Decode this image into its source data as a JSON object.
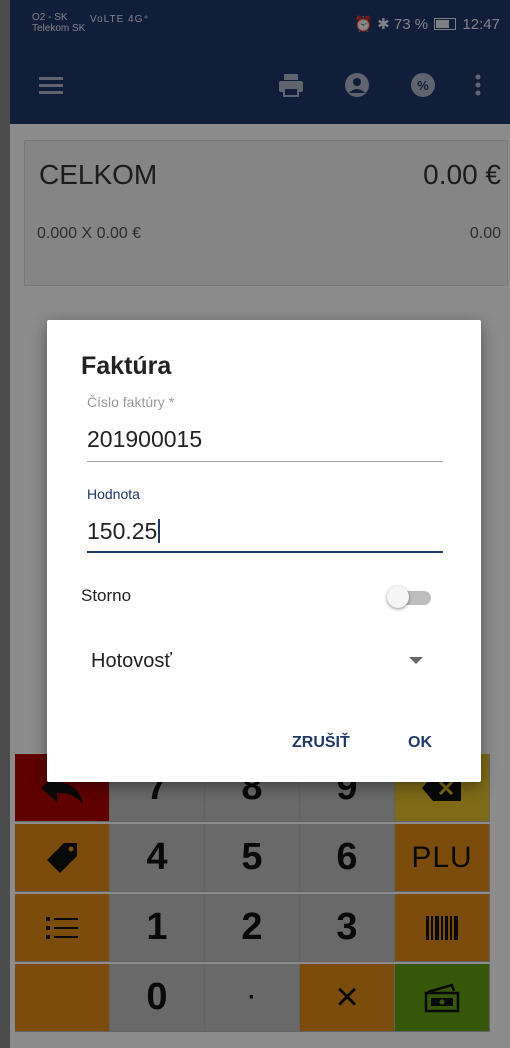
{
  "status_bar": {
    "carrier_line1": "O2 - SK",
    "carrier_line2": "Telekom SK",
    "network_badges": "VoLTE 4G⁺",
    "battery_percent": "73 %",
    "time": "12:47"
  },
  "app_bar": {
    "icons": [
      "menu-icon",
      "printer-icon",
      "account-icon",
      "discount-icon",
      "more-vert-icon"
    ]
  },
  "total": {
    "label": "CELKOM",
    "value": "0.00 €",
    "line_left": "0.000  X  0.00  €",
    "line_right": "0.00"
  },
  "dialog": {
    "title": "Faktúra",
    "invoice_label": "Číslo faktúry *",
    "invoice_value": "201900015",
    "amount_label": "Hodnota",
    "amount_value": "150.25",
    "storno_label": "Storno",
    "storno_on": false,
    "payment_method": "Hotovosť",
    "cancel_label": "ZRUŠIŤ",
    "ok_label": "OK"
  },
  "keypad": {
    "row1": [
      "",
      "7",
      "8",
      "9",
      ""
    ],
    "row2": [
      "",
      "4",
      "5",
      "6",
      "PLU"
    ],
    "row3": [
      "",
      "1",
      "2",
      "3",
      ""
    ],
    "row4": [
      "",
      "0",
      "·",
      "×",
      ""
    ]
  },
  "colors": {
    "primary": "#1f3868",
    "key_orange": "#e08a16",
    "key_red": "#b00000",
    "key_yellow": "#e6c12a",
    "key_green": "#5f9e10",
    "key_gray": "#bfbfbf"
  }
}
